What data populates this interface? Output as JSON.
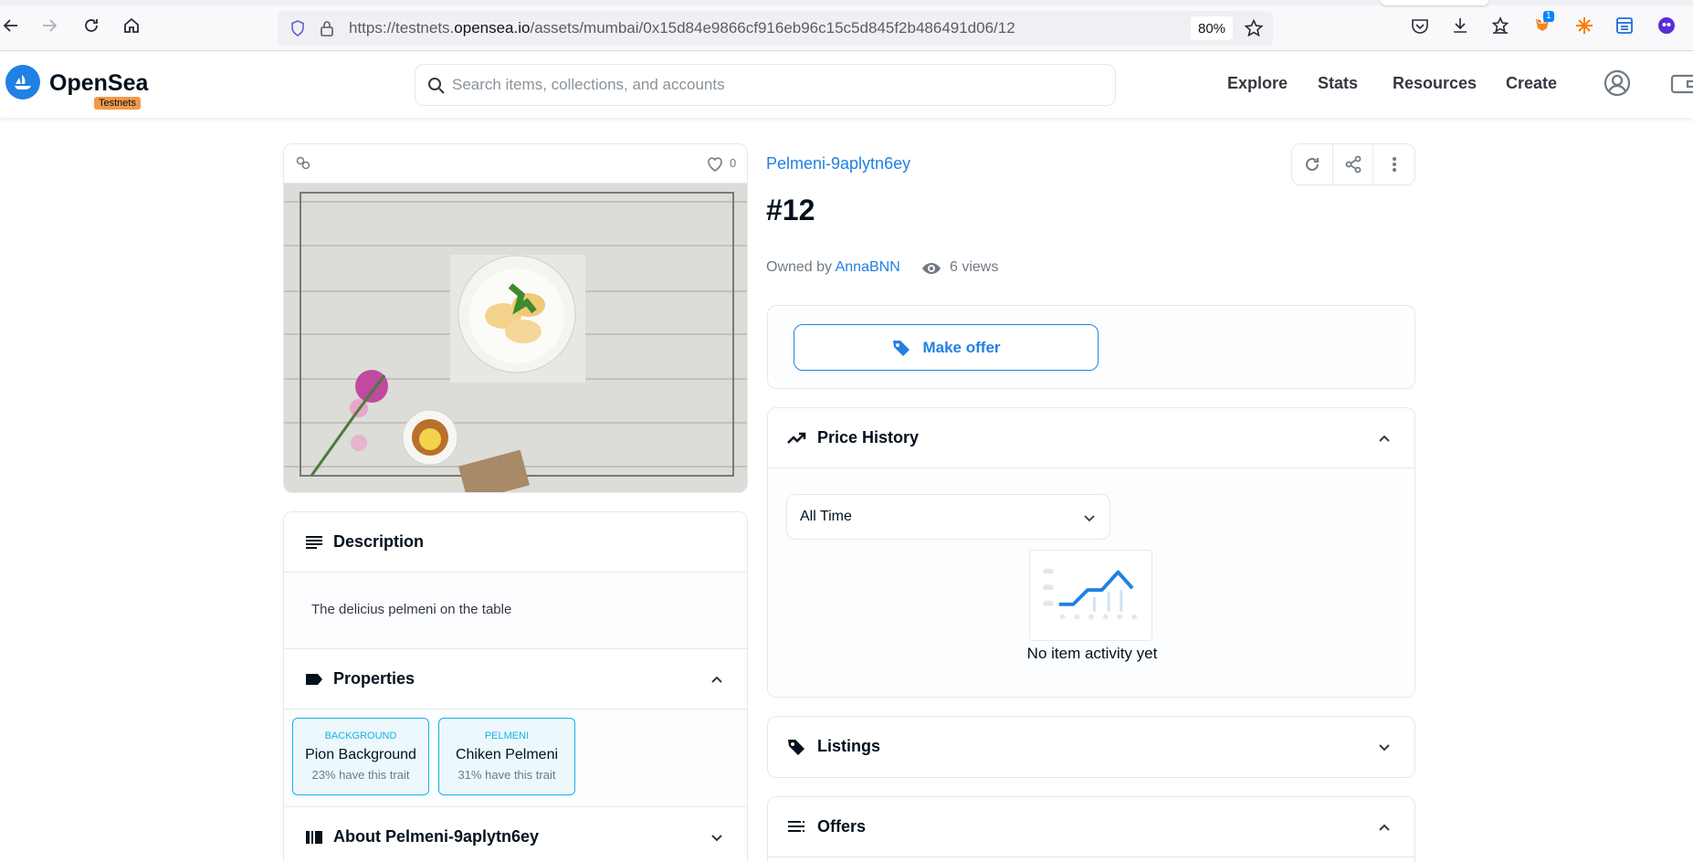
{
  "browser": {
    "url_prefix": "https://testnets.",
    "url_host": "opensea.io",
    "url_path": "/assets/mumbai/0x15d84e9866cf916eb96c15c5d845f2b486491d06/12",
    "zoom": "80%",
    "extension_badge": "1"
  },
  "header": {
    "brand": "OpenSea",
    "env_badge": "Testnets",
    "search_placeholder": "Search items, collections, and accounts",
    "nav": [
      "Explore",
      "Stats",
      "Resources",
      "Create"
    ]
  },
  "asset": {
    "favorites": "0",
    "collection": "Pelmeni-9aplytn6ey",
    "token_id": "#12",
    "owned_by_label": "Owned by",
    "owner": "AnnaBNN",
    "views": "6 views",
    "make_offer": "Make offer"
  },
  "description": {
    "title": "Description",
    "text": "The delicius pelmeni on the table"
  },
  "properties": {
    "title": "Properties",
    "traits": [
      {
        "type": "BACKGROUND",
        "value": "Pion Background",
        "rarity": "23% have this trait"
      },
      {
        "type": "PELMENI",
        "value": "Chiken Pelmeni",
        "rarity": "31% have this trait"
      }
    ]
  },
  "about": {
    "title": "About Pelmeni-9aplytn6ey"
  },
  "price_history": {
    "title": "Price History",
    "range": "All Time",
    "empty": "No item activity yet"
  },
  "listings": {
    "title": "Listings"
  },
  "offers": {
    "title": "Offers"
  },
  "colors": {
    "accent": "#2081e2",
    "trait": "#15b2e5",
    "testnets": "#f2994a"
  }
}
